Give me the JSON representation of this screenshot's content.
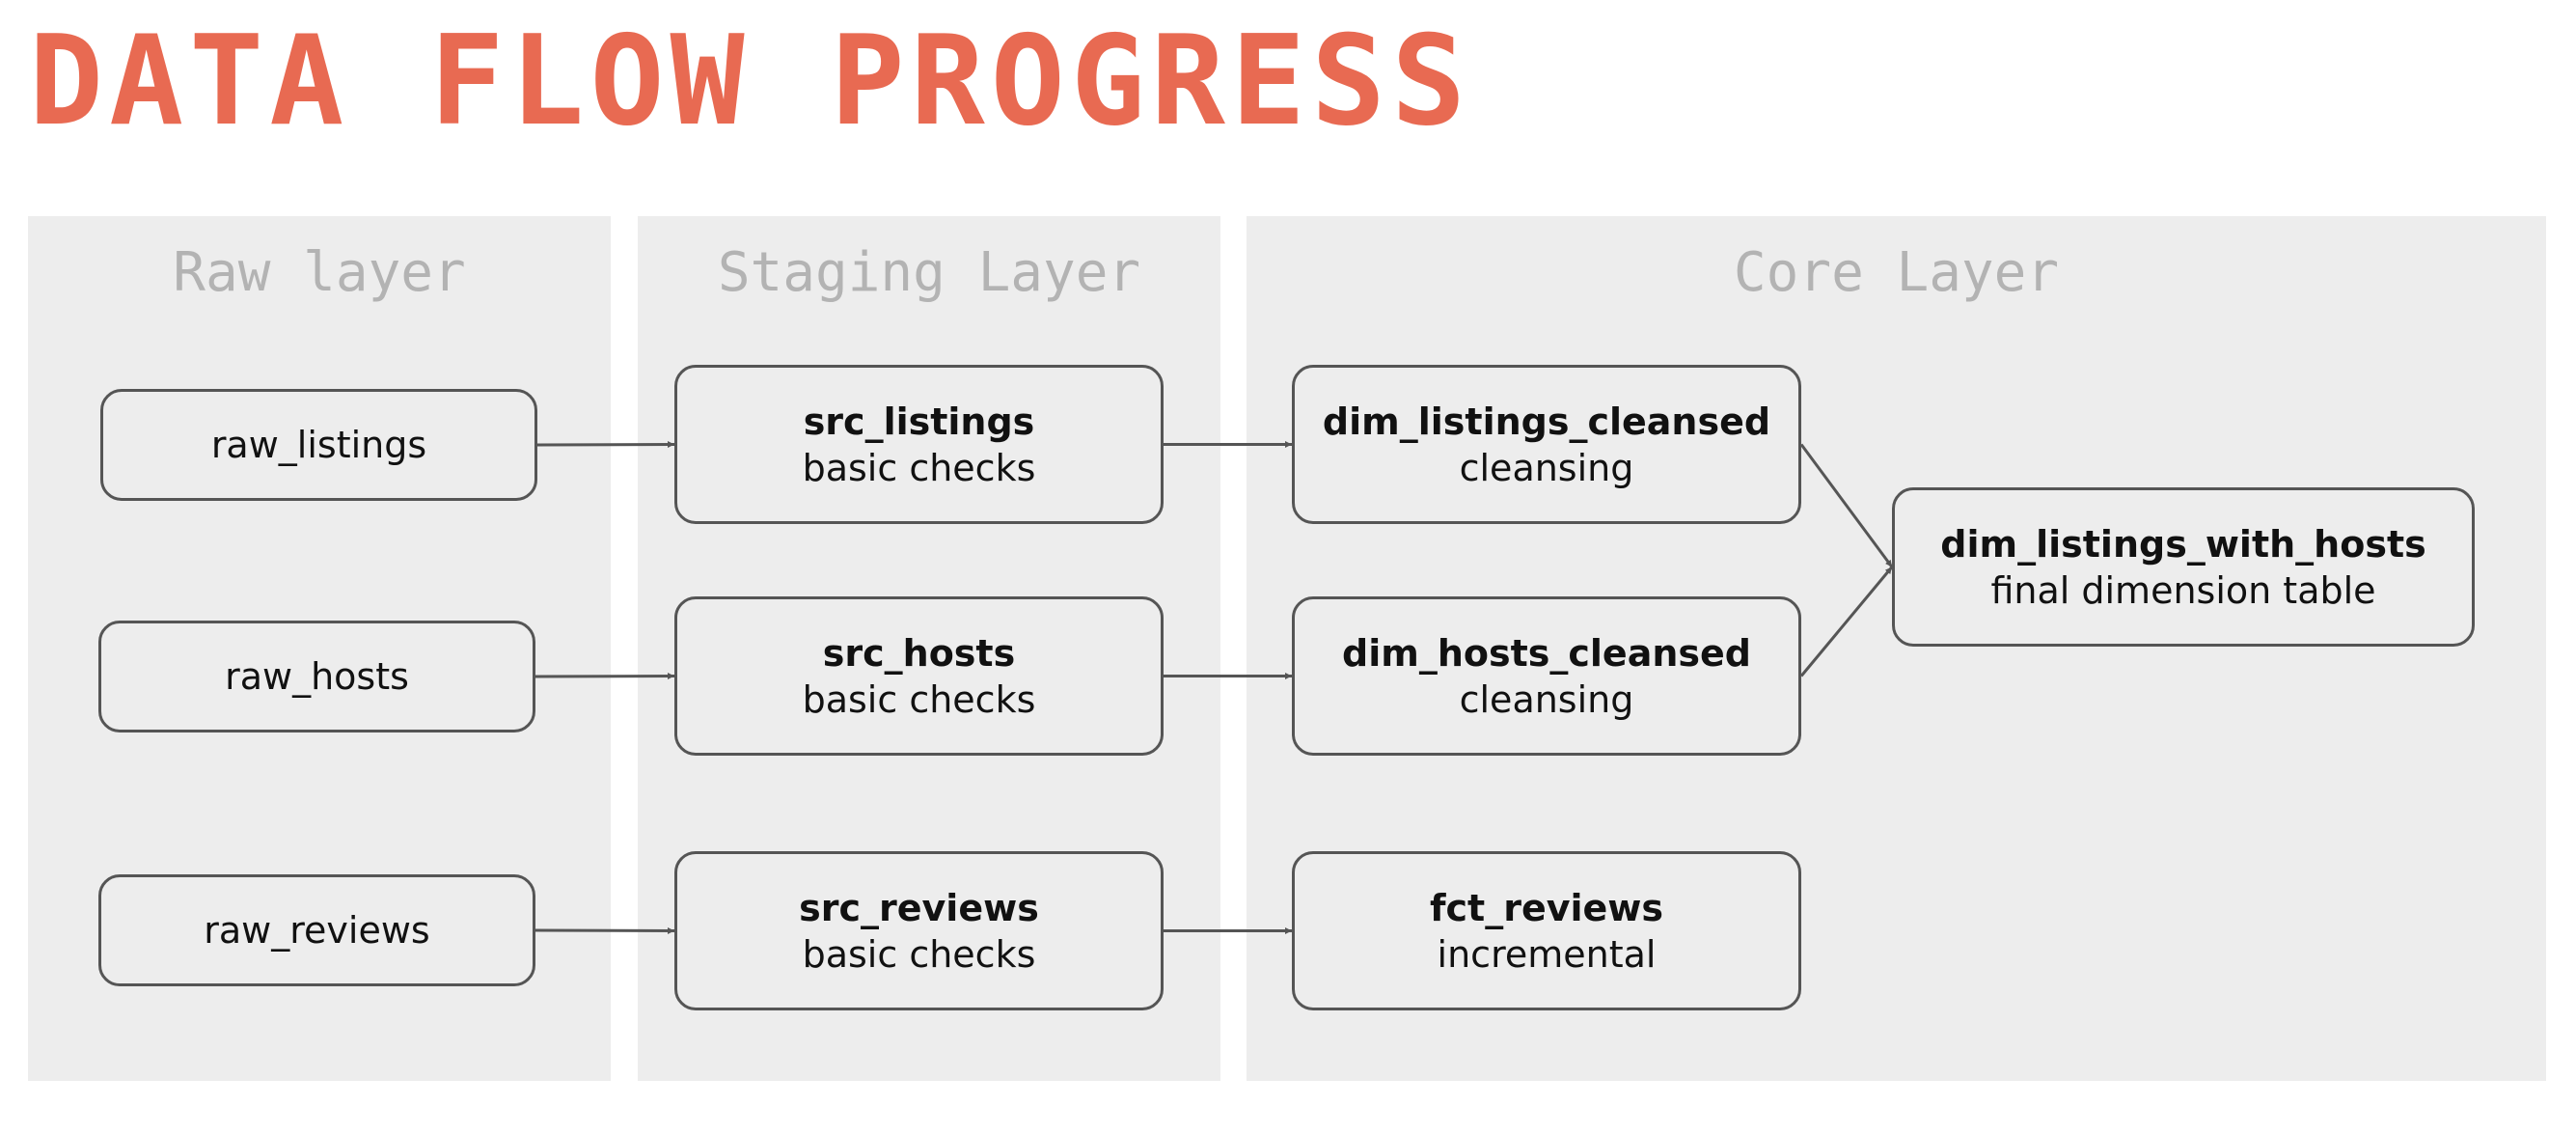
{
  "title": "DATA FLOW PROGRESS",
  "colors": {
    "title": "#e86a52",
    "lane_background": "#ededed",
    "lane_title": "#b3b3b3",
    "node_border": "#555555",
    "arrow": "#555555"
  },
  "lanes": {
    "raw": "Raw layer",
    "staging": "Staging Layer",
    "core": "Core Layer"
  },
  "nodes": {
    "raw_listings": {
      "name": "raw_listings"
    },
    "raw_hosts": {
      "name": "raw_hosts"
    },
    "raw_reviews": {
      "name": "raw_reviews"
    },
    "src_listings": {
      "name": "src_listings",
      "desc": "basic checks"
    },
    "src_hosts": {
      "name": "src_hosts",
      "desc": "basic checks"
    },
    "src_reviews": {
      "name": "src_reviews",
      "desc": "basic checks"
    },
    "dim_listings_cleansed": {
      "name": "dim_listings_cleansed",
      "desc": "cleansing"
    },
    "dim_hosts_cleansed": {
      "name": "dim_hosts_cleansed",
      "desc": "cleansing"
    },
    "fct_reviews": {
      "name": "fct_reviews",
      "desc": "incremental"
    },
    "dim_listings_with_hosts": {
      "name": "dim_listings_with_hosts",
      "desc": "final dimension table"
    }
  },
  "edges": [
    [
      "raw_listings",
      "src_listings"
    ],
    [
      "raw_hosts",
      "src_hosts"
    ],
    [
      "raw_reviews",
      "src_reviews"
    ],
    [
      "src_listings",
      "dim_listings_cleansed"
    ],
    [
      "src_hosts",
      "dim_hosts_cleansed"
    ],
    [
      "src_reviews",
      "fct_reviews"
    ],
    [
      "dim_listings_cleansed",
      "dim_listings_with_hosts"
    ],
    [
      "dim_hosts_cleansed",
      "dim_listings_with_hosts"
    ]
  ]
}
